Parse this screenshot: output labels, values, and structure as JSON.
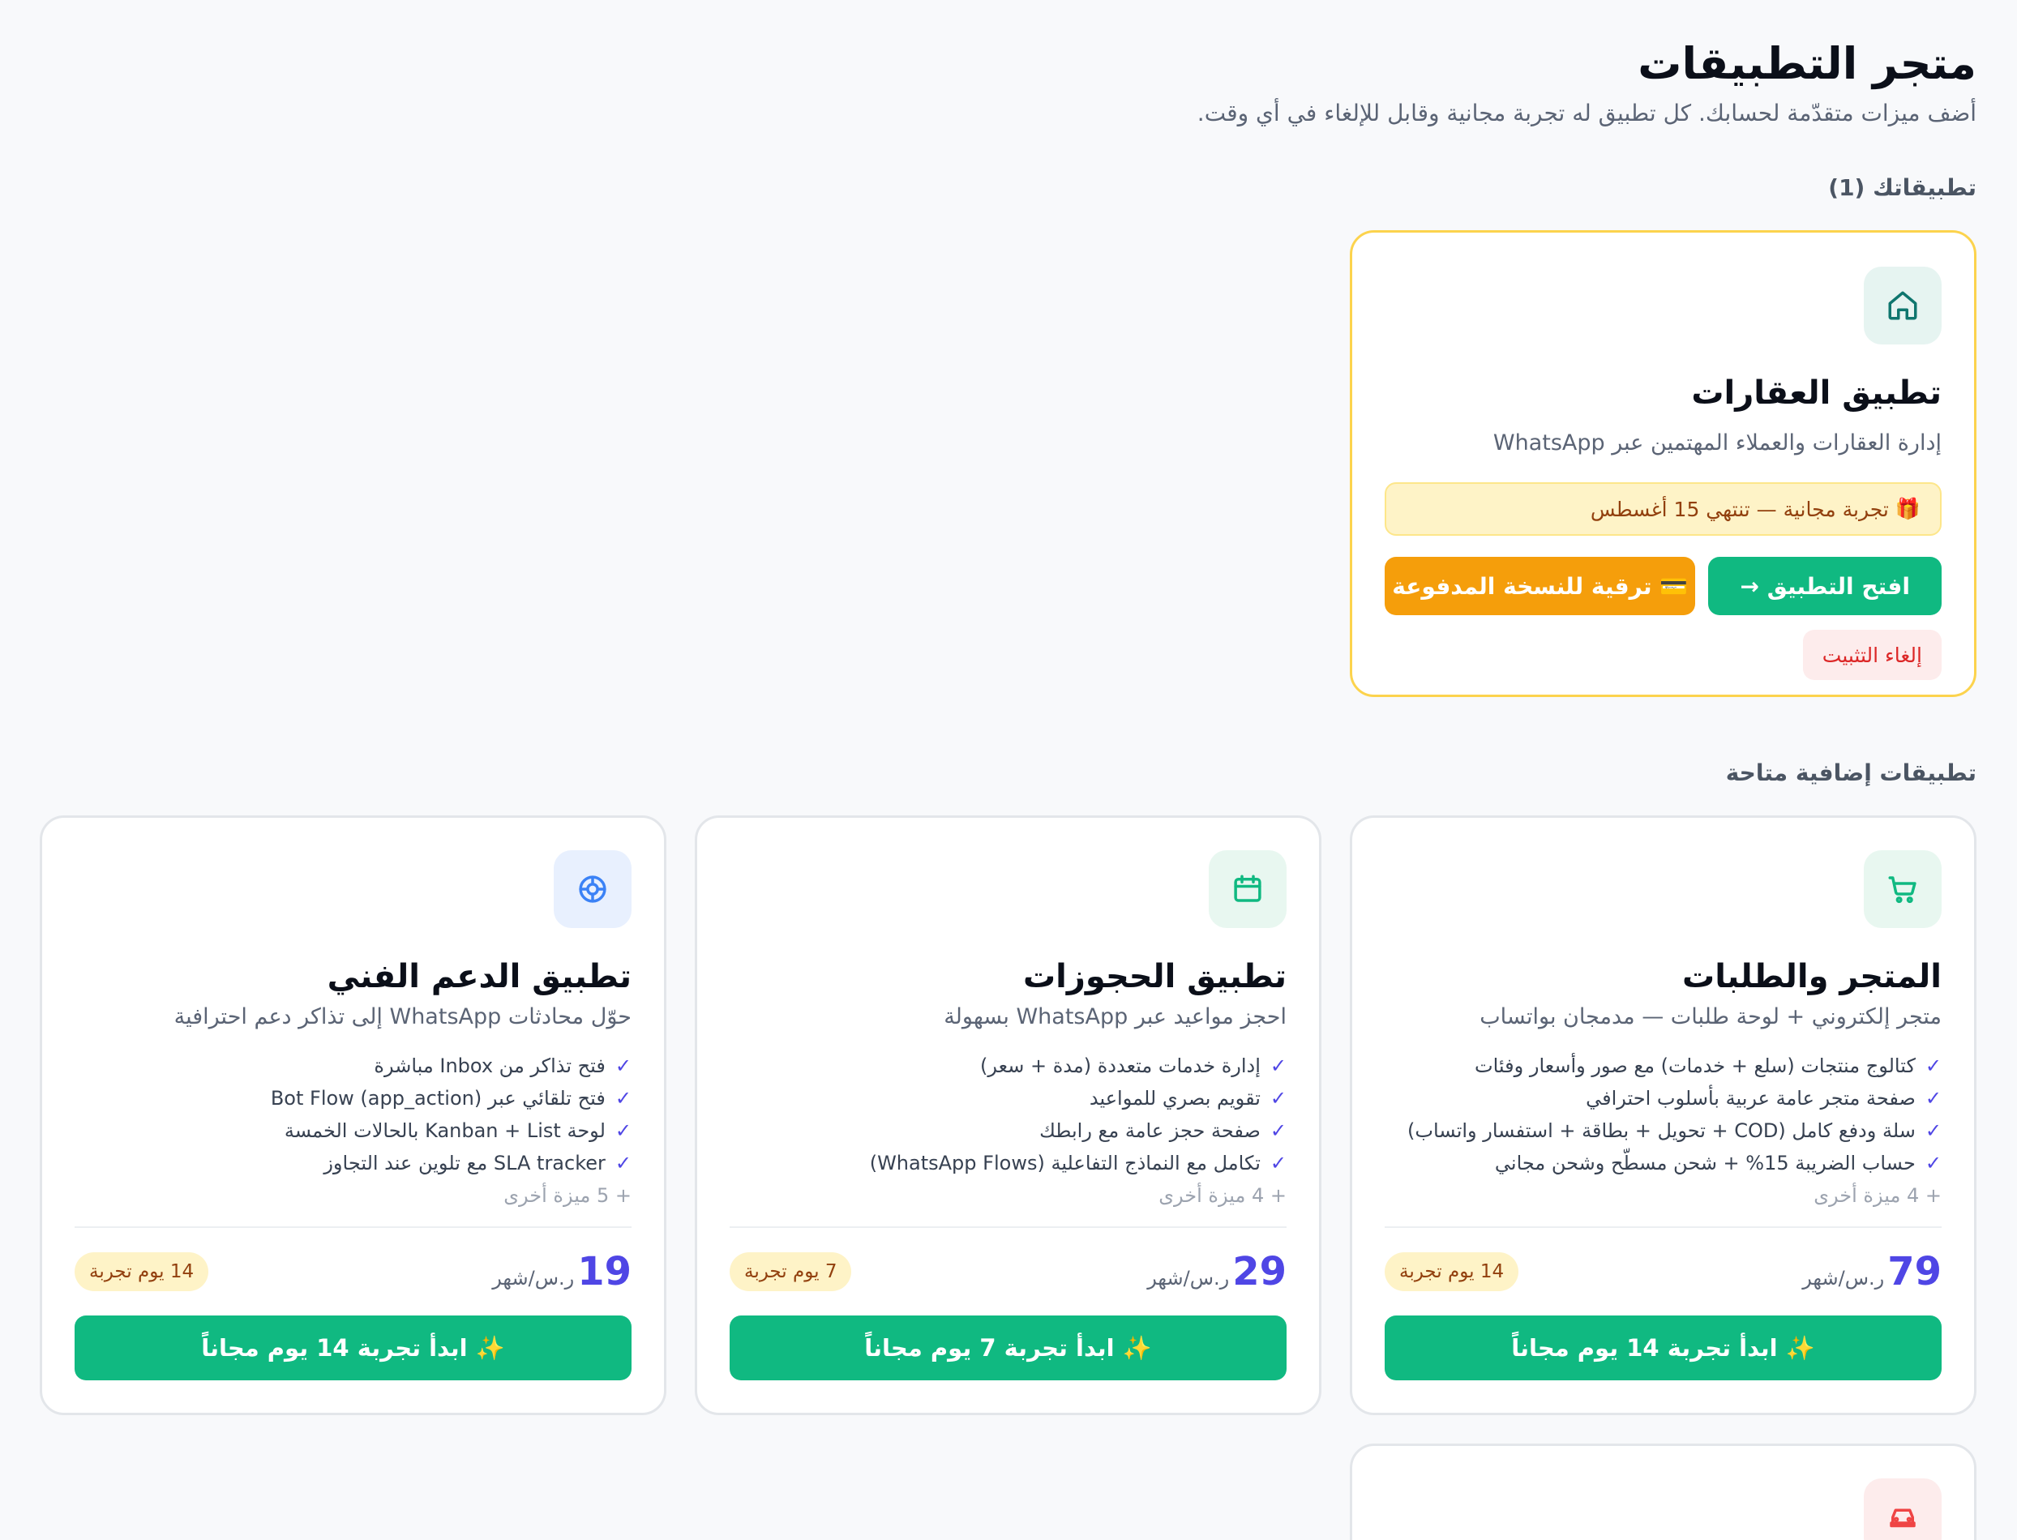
{
  "header": {
    "title": "متجر التطبيقات",
    "subtitle": "أضف ميزات متقدّمة لحسابك. كل تطبيق له تجربة مجانية وقابل للإلغاء في أي وقت."
  },
  "installed_section": {
    "title": "تطبيقاتك (1)",
    "app": {
      "icon": "home-icon",
      "name": "تطبيق العقارات",
      "description": "إدارة العقارات والعملاء المهتمين عبر WhatsApp",
      "trial_emoji": "🎁",
      "trial_text": "تجربة مجانية — تنتهي 15 أغسطس",
      "open_button": "افتح التطبيق →",
      "upgrade_button": "💳 ترقية للنسخة المدفوعة",
      "uninstall_button": "إلغاء التثبيت"
    }
  },
  "available_section": {
    "title": "تطبيقات إضافية متاحة",
    "apps": [
      {
        "icon": "cart-icon",
        "name": "المتجر والطلبات",
        "description": "متجر إلكتروني + لوحة طلبات — مدمجان بواتساب",
        "features": [
          "كتالوج منتجات (سلع + خدمات) مع صور وأسعار وفئات",
          "صفحة متجر عامة عربية بأسلوب احترافي",
          "سلة ودفع كامل (COD + تحويل + بطاقة + استفسار واتساب)",
          "حساب الضريبة 15% + شحن مسطّح وشحن مجاني"
        ],
        "more": "+ 4 ميزة أخرى",
        "price": "79",
        "price_unit": "ر.س/شهر",
        "trial_badge": "14 يوم تجربة",
        "start_button": "✨ ابدأ تجربة 14 يوم مجاناً"
      },
      {
        "icon": "calendar-icon",
        "name": "تطبيق الحجوزات",
        "description": "احجز مواعيد عبر WhatsApp بسهولة",
        "features": [
          "إدارة خدمات متعددة (مدة + سعر)",
          "تقويم بصري للمواعيد",
          "صفحة حجز عامة مع رابطك",
          "تكامل مع النماذج التفاعلية (WhatsApp Flows)"
        ],
        "more": "+ 4 ميزة أخرى",
        "price": "29",
        "price_unit": "ر.س/شهر",
        "trial_badge": "7 يوم تجربة",
        "start_button": "✨ ابدأ تجربة 7 يوم مجاناً"
      },
      {
        "icon": "lifebuoy-icon",
        "name": "تطبيق الدعم الفني",
        "description": "حوّل محادثات WhatsApp إلى تذاكر دعم احترافية",
        "features": [
          "فتح تذاكر من Inbox مباشرة",
          "فتح تلقائي عبر Bot Flow (app_action)",
          "لوحة Kanban + List بالحالات الخمسة",
          "SLA tracker مع تلوين عند التجاوز"
        ],
        "more": "+ 5 ميزة أخرى",
        "price": "19",
        "price_unit": "ر.س/شهر",
        "trial_badge": "14 يوم تجربة",
        "start_button": "✨ ابدأ تجربة 14 يوم مجاناً"
      },
      {
        "icon": "car-icon"
      }
    ]
  },
  "colors": {
    "accent_green": "#10b981",
    "accent_amber": "#f59e0b",
    "price_indigo": "#4f46e5",
    "installed_border": "#fcd34d"
  }
}
